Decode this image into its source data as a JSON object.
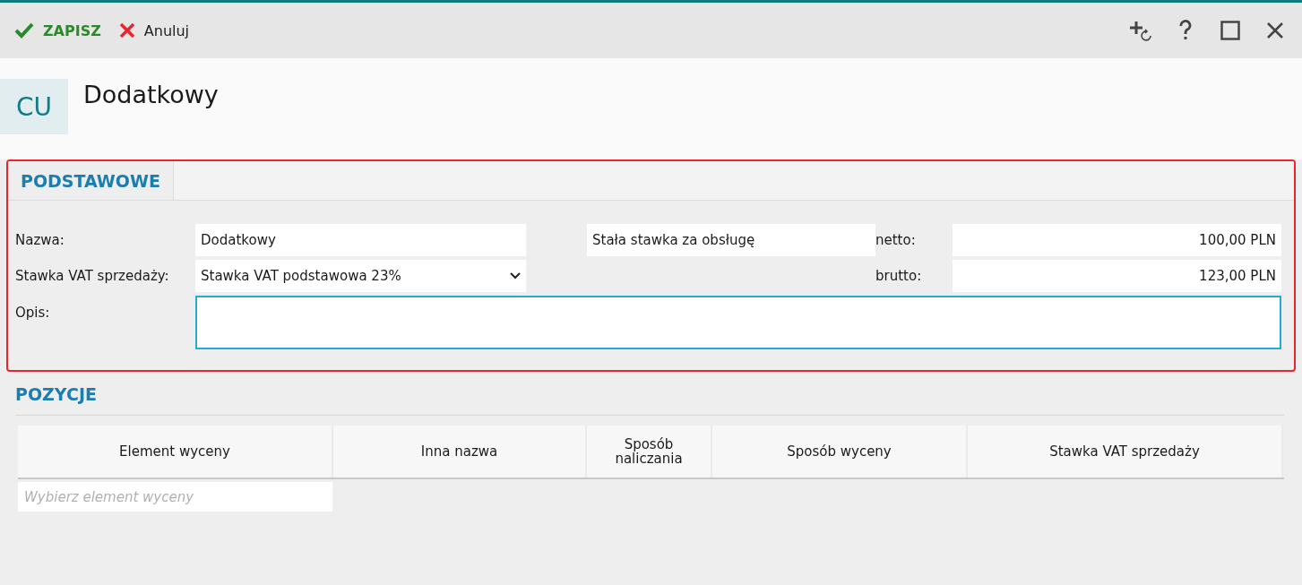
{
  "toolbar": {
    "save": "ZAPISZ",
    "cancel": "Anuluj"
  },
  "header": {
    "badge": "CU",
    "title": "Dodatkowy"
  },
  "tabs": [
    {
      "label": "PODSTAWOWE",
      "selected": true
    }
  ],
  "form": {
    "name_label": "Nazwa:",
    "name_value": "Dodatkowy",
    "type_value": "Stała stawka za obsługę",
    "netto_label": "netto:",
    "netto_value": "100,00 PLN",
    "vat_label": "Stawka VAT sprzedaży:",
    "vat_value": "Stawka VAT podstawowa 23%",
    "brutto_label": "brutto:",
    "brutto_value": "123,00 PLN",
    "desc_label": "Opis:",
    "desc_focused": true
  },
  "positions": {
    "title": "POZYCJE",
    "columns": [
      "Element wyceny",
      "Inna nazwa",
      "Sposób naliczania",
      "Sposób wyceny",
      "Stawka VAT sprzedaży"
    ],
    "placeholder": "Wybierz element wyceny"
  }
}
